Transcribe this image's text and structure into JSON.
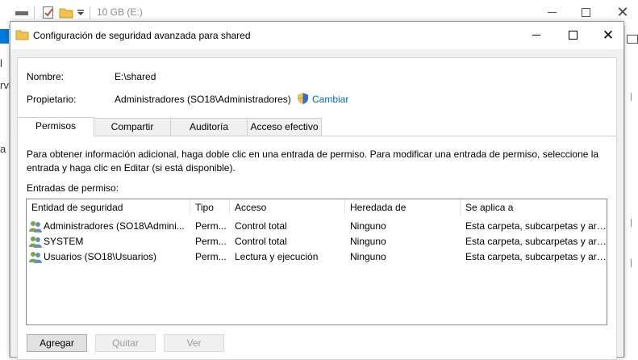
{
  "explorer": {
    "drive_label": "10 GB (E:)",
    "left_fragments": [
      "l",
      "rvi",
      "a"
    ]
  },
  "dialog": {
    "title": "Configuración de seguridad avanzada para shared",
    "name_label": "Nombre:",
    "name_value": "E:\\shared",
    "owner_label": "Propietario:",
    "owner_value": "Administradores (SO18\\Administradores)",
    "change_link": "Cambiar",
    "tabs": [
      {
        "label": "Permisos",
        "active": true
      },
      {
        "label": "Compartir",
        "active": false
      },
      {
        "label": "Auditoría",
        "active": false
      },
      {
        "label": "Acceso efectivo",
        "active": false
      }
    ],
    "info_text_line1": "Para obtener información adicional, haga doble clic en una entrada de permiso. Para modificar una entrada de permiso, seleccione la",
    "info_text_line2": "entrada y haga clic en Editar (si está disponible).",
    "entries_label": "Entradas de permiso:",
    "columns": [
      "Entidad de seguridad",
      "Tipo",
      "Acceso",
      "Heredada de",
      "Se aplica a"
    ],
    "rows": [
      {
        "entity": "Administradores (SO18\\Admini...",
        "type": "Perm...",
        "access": "Control total",
        "inherited": "Ninguno",
        "applies": "Esta carpeta, subcarpetas y arc..."
      },
      {
        "entity": "SYSTEM",
        "type": "Perm...",
        "access": "Control total",
        "inherited": "Ninguno",
        "applies": "Esta carpeta, subcarpetas y arc..."
      },
      {
        "entity": "Usuarios (SO18\\Usuarios)",
        "type": "Perm...",
        "access": "Lectura y ejecución",
        "inherited": "Ninguno",
        "applies": "Esta carpeta, subcarpetas y arc..."
      }
    ],
    "buttons": {
      "add": "Agregar",
      "remove": "Quitar",
      "view": "Ver"
    }
  },
  "colors": {
    "link": "#0066cc",
    "folder": "#f2c14e",
    "accent": "#0078d7"
  }
}
